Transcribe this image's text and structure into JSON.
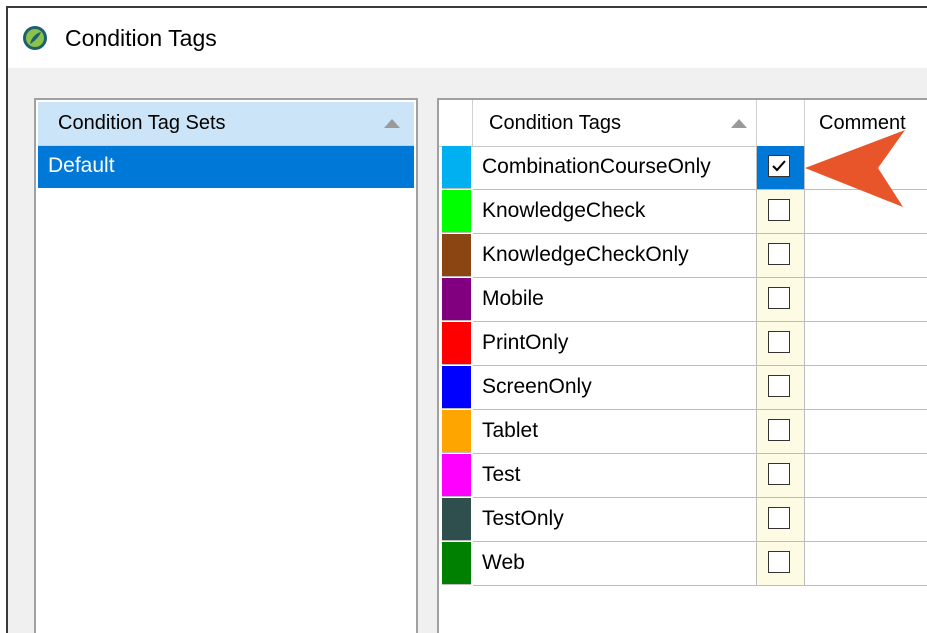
{
  "window": {
    "title": "Condition Tags",
    "icon": "flare-app-icon"
  },
  "left_panel": {
    "header": "Condition Tag Sets",
    "sort_indicator": "ascending",
    "items": [
      {
        "label": "Default",
        "selected": true
      }
    ]
  },
  "grid": {
    "headers": {
      "name": "Condition Tags",
      "comment": "Comment"
    },
    "sort_indicator": "ascending",
    "rows": [
      {
        "name": "CombinationCourseOnly",
        "color": "#00b0f0",
        "checked": true,
        "comment": ""
      },
      {
        "name": "KnowledgeCheck",
        "color": "#00ff00",
        "checked": false,
        "comment": ""
      },
      {
        "name": "KnowledgeCheckOnly",
        "color": "#8b4513",
        "checked": false,
        "comment": ""
      },
      {
        "name": "Mobile",
        "color": "#800080",
        "checked": false,
        "comment": ""
      },
      {
        "name": "PrintOnly",
        "color": "#ff0000",
        "checked": false,
        "comment": ""
      },
      {
        "name": "ScreenOnly",
        "color": "#0000ff",
        "checked": false,
        "comment": ""
      },
      {
        "name": "Tablet",
        "color": "#ffa500",
        "checked": false,
        "comment": ""
      },
      {
        "name": "Test",
        "color": "#ff00ff",
        "checked": false,
        "comment": ""
      },
      {
        "name": "TestOnly",
        "color": "#2f4f4f",
        "checked": false,
        "comment": ""
      },
      {
        "name": "Web",
        "color": "#008000",
        "checked": false,
        "comment": ""
      }
    ]
  },
  "annotation": {
    "icon": "callout-arrow-icon",
    "color": "#e8552b"
  }
}
